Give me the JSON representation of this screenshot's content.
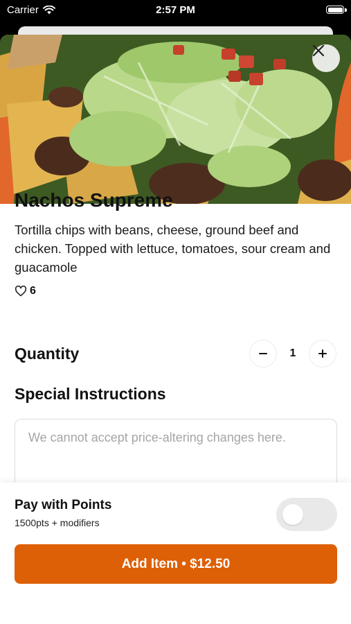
{
  "status_bar": {
    "carrier": "Carrier",
    "time": "2:57 PM"
  },
  "item": {
    "title": "Nachos Supreme",
    "description": "Tortilla chips with beans, cheese, ground beef and chicken. Topped with lettuce, tomatoes, sour cream and guacamole",
    "likes": "6",
    "icons": {
      "close": "close-icon",
      "like": "heart-icon"
    }
  },
  "quantity": {
    "label": "Quantity",
    "value": "1",
    "decrement": "−",
    "increment": "+"
  },
  "special_instructions": {
    "label": "Special Instructions",
    "placeholder": "We cannot accept price-altering changes here."
  },
  "points": {
    "title": "Pay with Points",
    "subtitle": "1500pts + modifiers",
    "enabled": false
  },
  "cta": {
    "label": "Add Item • $12.50",
    "color": "#dd5f06"
  }
}
